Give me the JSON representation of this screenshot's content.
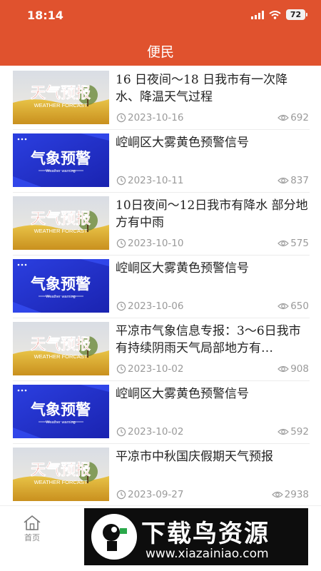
{
  "status_bar": {
    "time": "18:14",
    "battery": "72"
  },
  "header": {
    "title": "便民"
  },
  "items": [
    {
      "thumb": "weather-forecast",
      "title": "16 日夜间～18 日我市有一次降水、降温天气过程",
      "date": "2023-10-16",
      "views": "692"
    },
    {
      "thumb": "weather-warning",
      "title": "崆峒区大雾黄色预警信号",
      "date": "2023-10-11",
      "views": "837"
    },
    {
      "thumb": "weather-forecast",
      "title": "10日夜间～12日我市有降水 部分地方有中雨",
      "date": "2023-10-10",
      "views": "575"
    },
    {
      "thumb": "weather-warning",
      "title": "崆峒区大雾黄色预警信号",
      "date": "2023-10-06",
      "views": "650"
    },
    {
      "thumb": "weather-forecast",
      "title": "平凉市气象信息专报：3～6日我市有持续阴雨天气局部地方有…",
      "date": "2023-10-02",
      "views": "908"
    },
    {
      "thumb": "weather-warning",
      "title": "崆峒区大雾黄色预警信号",
      "date": "2023-10-02",
      "views": "592"
    },
    {
      "thumb": "weather-forecast",
      "title": "平凉市中秋国庆假期天气预报",
      "date": "2023-09-27",
      "views": "2938"
    }
  ],
  "thumb_text": {
    "forecast_title": "天气预报",
    "forecast_sub": "WEATHER FORCAST",
    "warning_title": "气象预警",
    "warning_sub": "Weather warning"
  },
  "tabbar": {
    "home_label": "首页"
  },
  "watermark": {
    "title": "下载鸟资源",
    "url": "www.xiazainiao.com"
  },
  "colors": {
    "header": "#e0522e",
    "meta": "#9a9a9a",
    "warning_bg": "#2233cc",
    "forecast_text": "#cc2a1a"
  }
}
